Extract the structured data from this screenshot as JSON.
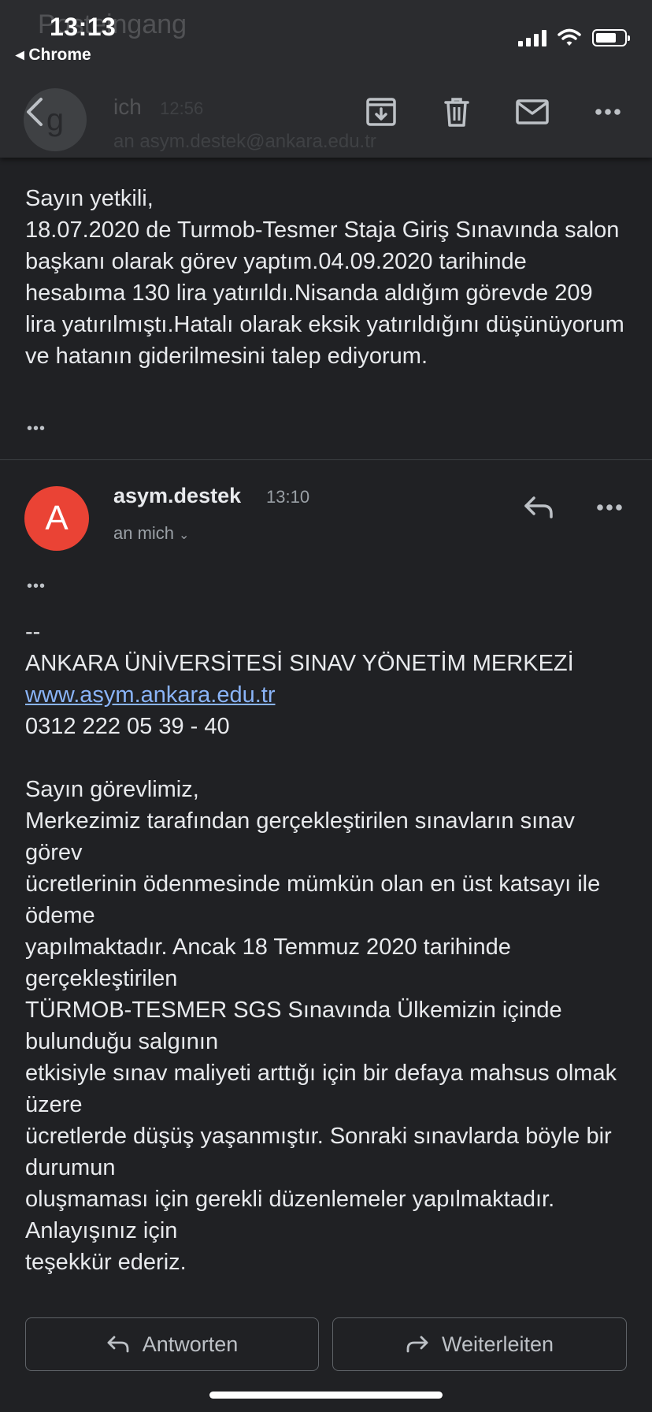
{
  "status_bar": {
    "time": "13:13",
    "back_app": "◂ Chrome"
  },
  "background_header": {
    "subject": "Posteingang",
    "avatar_letter": "g",
    "sender": "ich",
    "time": "12:56",
    "to": "an asym.destek@ankara.edu.tr"
  },
  "toolbar": {
    "icons": [
      "back-arrow-icon",
      "archive-icon",
      "trash-icon",
      "mail-icon",
      "more-icon"
    ]
  },
  "first_message": {
    "body": "Sayın yetkili,\n18.07.2020 de Turmob-Tesmer Staja Giriş Sınavında salon başkanı olarak görev yaptım.04.09.2020 tarihinde hesabıma 130 lira yatırıldı.Nisanda aldığım görevde 209 lira yatırılmıştı.Hatalı olarak eksik yatırıldığını düşünüyorum ve hatanın giderilmesini talep ediyorum.",
    "ellipsis": "•••"
  },
  "second_message": {
    "avatar_letter": "A",
    "avatar_color": "#ea4335",
    "sender": "asym.destek",
    "time": "13:10",
    "recipient": "an mich",
    "ellipsis": "•••",
    "sig_dash": "--",
    "org_name": "ANKARA ÜNİVERSİTESİ SINAV YÖNETİM MERKEZİ",
    "website": "www.asym.ankara.edu.tr",
    "phone": "0312 222 05 39 - 40",
    "body": "Sayın görevlimiz,\nMerkezimiz tarafından gerçekleştirilen sınavların sınav görev\nücretlerinin ödenmesinde mümkün olan en üst katsayı ile ödeme\nyapılmaktadır. Ancak 18 Temmuz 2020 tarihinde gerçekleştirilen\nTÜRMOB-TESMER SGS Sınavında Ülkemizin içinde bulunduğu salgının\netkisiyle sınav maliyeti arttığı için bir defaya mahsus olmak üzere\nücretlerde düşüş yaşanmıştır. Sonraki sınavlarda böyle bir durumun\noluşmaması için gerekli düzenlemeler yapılmaktadır. Anlayışınız için\nteşekkür ederiz."
  },
  "actions": {
    "reply_label": "Antworten",
    "forward_label": "Weiterleiten"
  },
  "colors": {
    "background": "#202124",
    "link": "#8ab4f8",
    "text": "#e8eaed",
    "muted": "#9aa0a6"
  }
}
